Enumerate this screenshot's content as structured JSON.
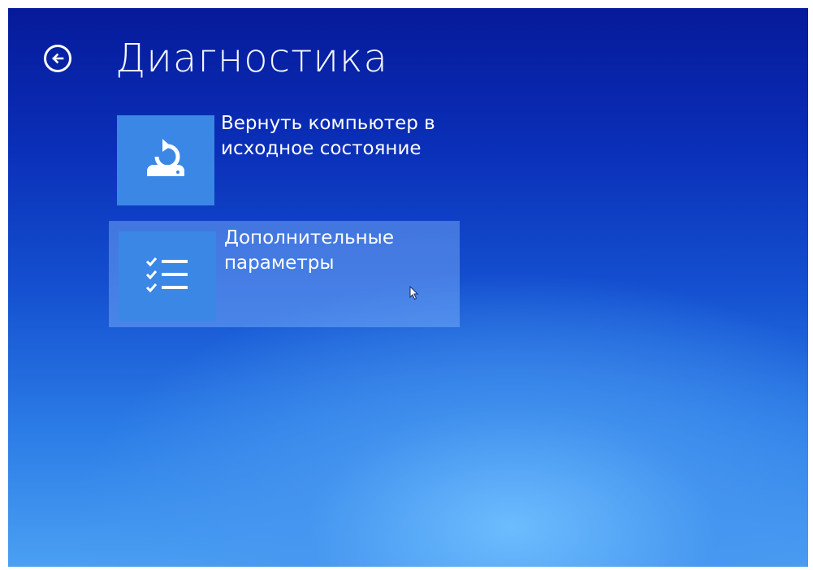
{
  "header": {
    "title": "Диагностика",
    "back_icon": "back-arrow-icon"
  },
  "options": [
    {
      "label_line1": "Вернуть компьютер в",
      "label_line2": "исходное состояние",
      "icon": "reset-pc-icon",
      "selected": false
    },
    {
      "label_line1": "Дополнительные",
      "label_line2": "параметры",
      "icon": "checklist-icon",
      "selected": true
    }
  ],
  "colors": {
    "background_top": "#061a9a",
    "background_bottom": "#4aa0f2",
    "tile": "#3a87e6",
    "text": "#ffffff"
  }
}
